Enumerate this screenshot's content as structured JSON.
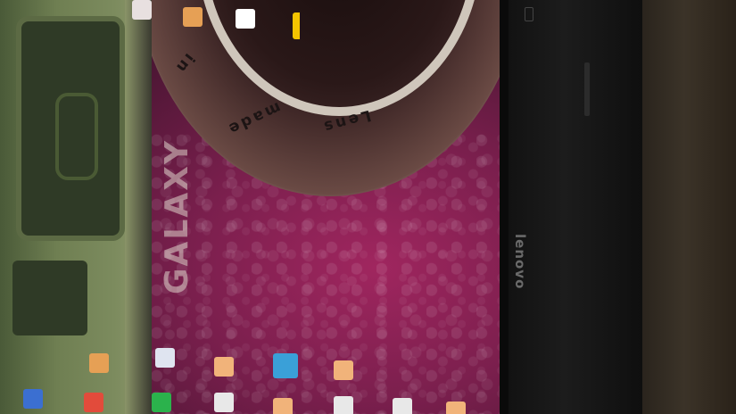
{
  "scene": {
    "description_kind": "photo",
    "brand_text": "lenovo",
    "lens_text": [
      "Lens",
      "made",
      "in"
    ],
    "camera_logo": "GALAXY"
  },
  "colors": {
    "screen": "#7a1f4d",
    "bezel": "#141414",
    "camera_body": "#6f7f52"
  },
  "icons": [
    {
      "name": "folder-icon",
      "color": "#e6a055"
    },
    {
      "name": "app-icon",
      "color": "#ffffff"
    },
    {
      "name": "app-icon",
      "color": "#f4c400"
    },
    {
      "name": "folder-icon",
      "color": "#f1b37a"
    },
    {
      "name": "folder-icon",
      "color": "#f1b37a"
    },
    {
      "name": "app-icon",
      "color": "#3aa0d8"
    },
    {
      "name": "app-icon",
      "color": "#e8e0e0"
    },
    {
      "name": "folder-icon",
      "color": "#f1b37a"
    },
    {
      "name": "app-icon",
      "color": "#2bb24c"
    },
    {
      "name": "app-icon",
      "color": "#e24b3b"
    },
    {
      "name": "app-icon",
      "color": "#3b6fd1"
    },
    {
      "name": "app-icon",
      "color": "#e8e8e8"
    }
  ]
}
